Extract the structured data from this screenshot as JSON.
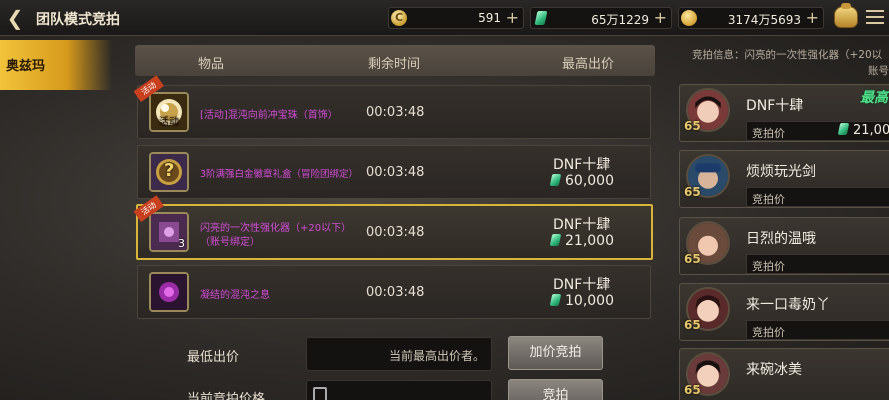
{
  "header": {
    "title": "团队模式竞拍",
    "currencies": [
      {
        "icon": "gold-c-coin-icon",
        "value": "591"
      },
      {
        "icon": "green-gem-icon",
        "value": "65万1229"
      },
      {
        "icon": "gold-coin-icon",
        "value": "3174万5693"
      }
    ],
    "plus": "+"
  },
  "tab": {
    "label": "奥兹玛"
  },
  "table": {
    "columns": [
      "物品",
      "剩余时间",
      "最高出价"
    ],
    "rows": [
      {
        "ribbon": "活动",
        "thumb_label": "活动",
        "count": "",
        "name_line1": "[活动]混沌向前冲宝珠（首饰）",
        "name_line2": "",
        "time": "00:03:48",
        "bidder": "",
        "price": ""
      },
      {
        "ribbon": "",
        "thumb_label": "?",
        "count": "",
        "name_line1": "3阶满强白金徽章礼盒（冒险团绑定）",
        "name_line2": "",
        "time": "00:03:48",
        "bidder": "DNF十肆",
        "price": "60,000"
      },
      {
        "ribbon": "活动",
        "thumb_label": "",
        "count": "3",
        "name_line1": "闪亮的一次性强化器（+20以下）",
        "name_line2": "（账号绑定）",
        "time": "00:03:48",
        "bidder": "DNF十肆",
        "price": "21,000"
      },
      {
        "ribbon": "",
        "thumb_label": "",
        "count": "",
        "name_line1": "凝结的混沌之息",
        "name_line2": "",
        "time": "00:03:48",
        "bidder": "DNF十肆",
        "price": "10,000"
      }
    ]
  },
  "bid": {
    "min_label": "最低出价",
    "min_value": "当前最高出价者。",
    "raise_button": "加价竞拍",
    "current_label": "当前竞拍价格",
    "bid_button": "竞拍"
  },
  "panel": {
    "info_line1": "竞拍信息：闪亮的一次性强化器（+20以",
    "info_line2": "账号",
    "highest_tag": "最高",
    "price_label": "竞拍价",
    "players": [
      {
        "level": "65",
        "name": "DNF十肆",
        "price": "21,00"
      },
      {
        "level": "65",
        "name": "烦烦玩光剑",
        "price": ""
      },
      {
        "level": "65",
        "name": "日烈的温哦",
        "price": ""
      },
      {
        "level": "65",
        "name": "来一口毒奶丫",
        "price": ""
      },
      {
        "level": "65",
        "name": "来碗冰美",
        "price": ""
      }
    ]
  },
  "colors": {
    "accent_gold": "#d8b43a",
    "item_purple": "#d44bd8",
    "gem_green": "#2fb67a",
    "highest_green": "#4fe08a"
  }
}
